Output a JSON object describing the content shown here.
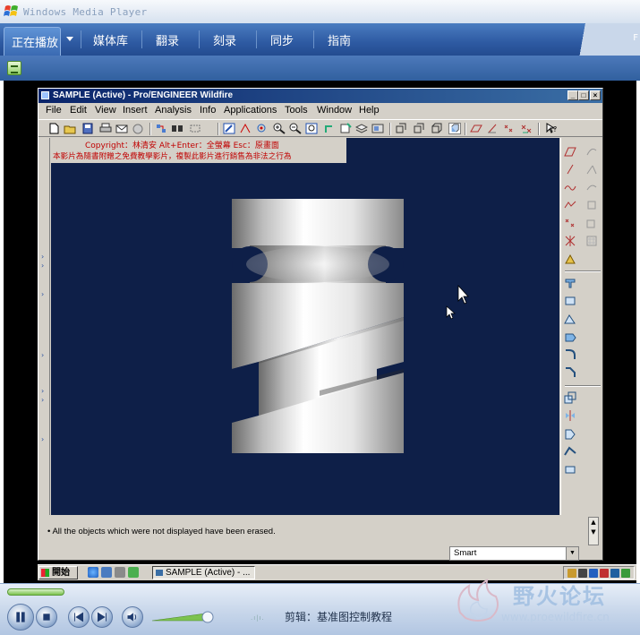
{
  "wmp": {
    "title": "Windows Media Player",
    "tabs": [
      {
        "label": "正在播放"
      },
      {
        "label": "媒体库"
      },
      {
        "label": "翻录"
      },
      {
        "label": "刻录"
      },
      {
        "label": "同步"
      },
      {
        "label": "指南"
      }
    ],
    "right_tab_partial": "F",
    "status_text": "剪辑：基准图控制教程",
    "watermark_cn": "野火论坛",
    "watermark_url": "www.proewildfire.cn"
  },
  "proe": {
    "title": "SAMPLE (Active) - Pro/ENGINEER Wildfire",
    "menus": [
      "File",
      "Edit",
      "View",
      "Insert",
      "Analysis",
      "Info",
      "Applications",
      "Tools",
      "Window",
      "Help"
    ],
    "copyright_line1": "Copyright：林清安     Alt+Enter：全螢幕     Esc：原畫面",
    "copyright_line2": "本影片為隨書附贈之免費教學影片，複製此影片進行銷售為非法之行為",
    "message": "All the objects which were not displayed have been erased.",
    "filter_value": "Smart"
  },
  "taskbar": {
    "start_label": "開始",
    "task_label": "SAMPLE (Active) - ..."
  },
  "colors": {
    "graphics_bg": "#0e1f48",
    "wmp_blue": "#2e5aa2",
    "copyright_red": "#c00000"
  }
}
